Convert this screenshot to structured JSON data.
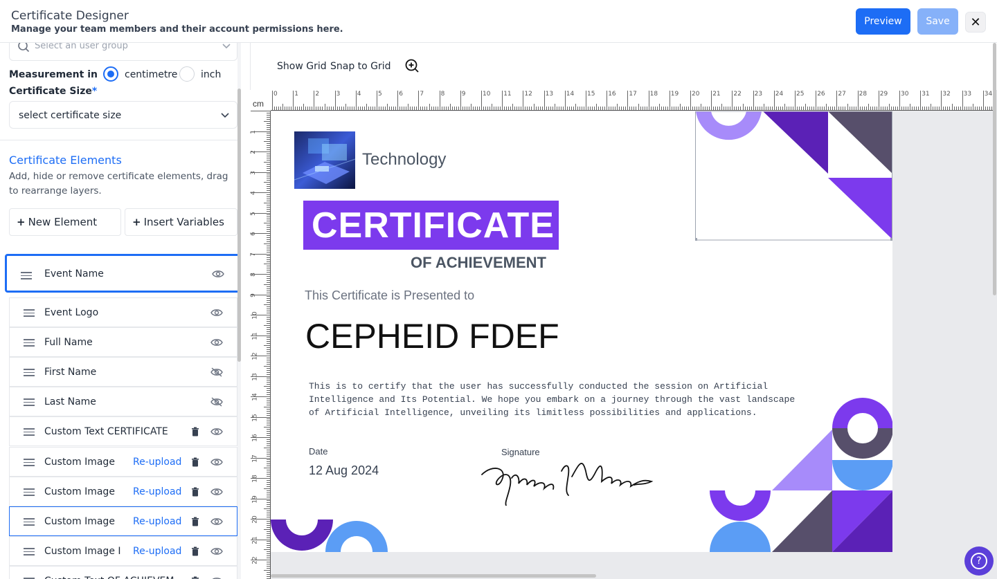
{
  "header": {
    "title": "Certificate Designer",
    "subtitle": "Manage your team members and their account permissions here.",
    "preview_label": "Preview",
    "save_label": "Save",
    "close_label": "✕"
  },
  "sidebar": {
    "group_placeholder": "Select an user group",
    "measurement_label": "Measurement in",
    "unit_options": [
      "centimetre",
      "inch"
    ],
    "unit_selected": "centimetre",
    "size_label": "Certificate Size",
    "size_required_mark": "*",
    "size_value": "select certificate size",
    "elements_title": "Certificate Elements",
    "elements_desc": "Add, hide or remove certificate elements, drag to rearrange layers.",
    "new_element_label": "New Element",
    "insert_variables_label": "Insert Variables",
    "elements": [
      {
        "label": "Event Name",
        "reupload": "",
        "trash": false,
        "visible": true
      },
      {
        "label": "Event Logo",
        "reupload": "",
        "trash": false,
        "visible": true
      },
      {
        "label": "Full Name",
        "reupload": "",
        "trash": false,
        "visible": true
      },
      {
        "label": "First Name",
        "reupload": "",
        "trash": false,
        "visible": false
      },
      {
        "label": "Last Name",
        "reupload": "",
        "trash": false,
        "visible": false
      },
      {
        "label": "Custom Text CERTIFICATE",
        "reupload": "",
        "trash": true,
        "visible": true
      },
      {
        "label": "Custom Image",
        "reupload": "Re-upload",
        "trash": true,
        "visible": true
      },
      {
        "label": "Custom Image",
        "reupload": "Re-upload",
        "trash": true,
        "visible": true
      },
      {
        "label": "Custom Image",
        "reupload": "Re-upload",
        "trash": true,
        "visible": true
      },
      {
        "label": "Custom Image I",
        "reupload": "Re-upload",
        "trash": true,
        "visible": true
      },
      {
        "label": "Custom Text OF ACHIEVEM...",
        "reupload": "",
        "trash": true,
        "visible": true
      }
    ]
  },
  "toolbar": {
    "show_grid_label": "Show Grid",
    "snap_grid_label": "Snap to Grid",
    "zoom_icon": "zoom-in-icon"
  },
  "ruler": {
    "unit": "cm",
    "top_labels": [
      "0",
      "1",
      "2",
      "3",
      "4",
      "5",
      "6",
      "7",
      "8",
      "9",
      "10",
      "11",
      "12",
      "13",
      "14",
      "15",
      "16",
      "17",
      "18",
      "19",
      "20",
      "21",
      "22",
      "23",
      "24",
      "25",
      "26",
      "27",
      "28",
      "29",
      "30",
      "31",
      "32",
      "33",
      "34"
    ],
    "left_labels": [
      "1",
      "2",
      "3",
      "4",
      "5",
      "6",
      "7",
      "8",
      "9",
      "10",
      "11",
      "12",
      "13",
      "14",
      "15",
      "16",
      "17",
      "18",
      "19",
      "20",
      "21",
      "22"
    ]
  },
  "certificate": {
    "org_name": "Technology",
    "banner_text": "CERTIFICATE",
    "sub_text": "OF ACHIEVEMENT",
    "presented_text": "This Certificate is Presented to",
    "recipient_name": "CEPHEID FDEF",
    "body_text": "This is to certify that the user has successfully conducted the session on Artificial Intelligence and Its Potential. We hope you embark on a journey through the vast landscape of Artificial Intelligence, unveiling its limitless possibilities and applications.",
    "date_label": "Date",
    "date_value": "12 Aug 2024",
    "signature_label": "Signature"
  },
  "colors": {
    "accent": "#1d6df5",
    "purple": "#7c3aed",
    "dark_purple": "#5b21b6",
    "light_purple": "#a78bfa",
    "slate": "#574f6b",
    "light_blue": "#5b9df5"
  },
  "help_label": "?"
}
